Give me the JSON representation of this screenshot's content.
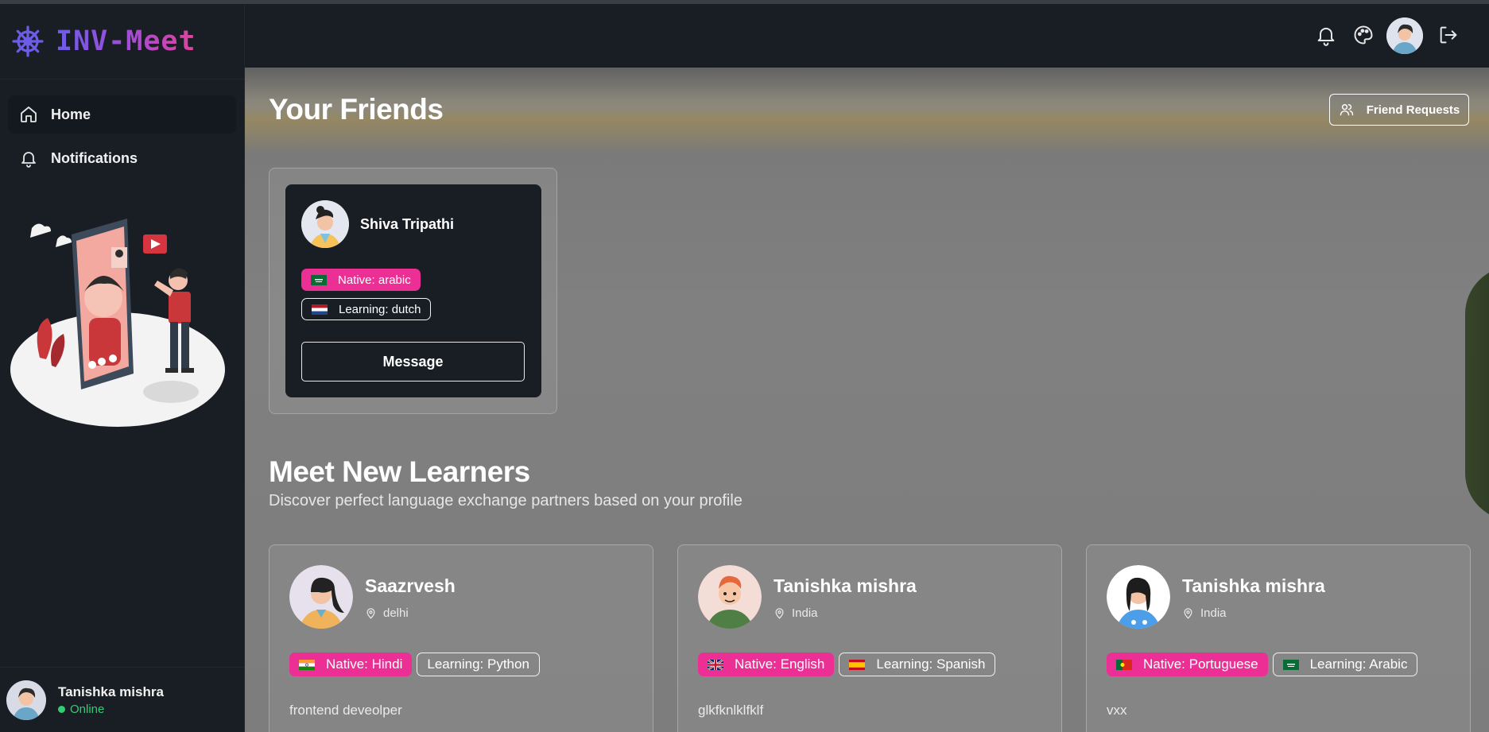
{
  "app": {
    "brand": "INV-Meet"
  },
  "sidebar": {
    "items": [
      {
        "label": "Home",
        "icon": "home-icon",
        "active": true
      },
      {
        "label": "Notifications",
        "icon": "bell-icon",
        "active": false
      }
    ],
    "user": {
      "name": "Tanishka mishra",
      "status": "Online"
    }
  },
  "friends": {
    "title": "Your Friends",
    "requests_label": "Friend Requests",
    "list": [
      {
        "name": "Shiva Tripathi",
        "native": "Native: arabic",
        "learning": "Learning: dutch",
        "message_label": "Message"
      }
    ]
  },
  "learners": {
    "title": "Meet New Learners",
    "subtitle": "Discover perfect language exchange partners based on your profile",
    "list": [
      {
        "name": "Saazrvesh",
        "location": "delhi",
        "native": "Native: Hindi",
        "learning": "Learning: Python",
        "bio": "frontend deveolper"
      },
      {
        "name": "Tanishka mishra",
        "location": "India",
        "native": "Native: English",
        "learning": "Learning: Spanish",
        "bio": "glkfknlklfklf"
      },
      {
        "name": "Tanishka mishra",
        "location": "India",
        "native": "Native: Portuguese",
        "learning": "Learning: Arabic",
        "bio": "vxx"
      }
    ]
  },
  "colors": {
    "accent_pink": "#ec2f95",
    "online_green": "#2fce73",
    "brand_purple": "#6c5ce7",
    "sidebar_bg": "#191e25"
  }
}
